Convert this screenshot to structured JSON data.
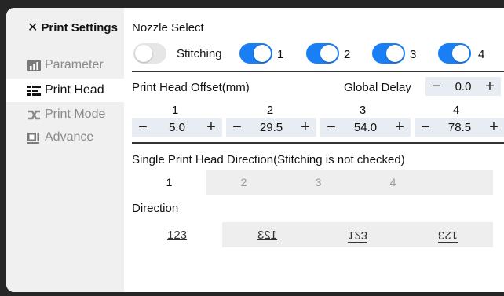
{
  "sidebar": {
    "close_glyph": "✕",
    "title": "Print Settings",
    "items": [
      {
        "label": "Parameter",
        "icon": "bar-chart-icon",
        "active": false
      },
      {
        "label": "Print Head",
        "icon": "list-icon",
        "active": true
      },
      {
        "label": "Print Mode",
        "icon": "shuffle-icon",
        "active": false
      },
      {
        "label": "Advance",
        "icon": "advance-icon",
        "active": false
      }
    ]
  },
  "nozzle": {
    "title": "Nozzle Select",
    "stitching_label": "Stitching",
    "stitching_on": false,
    "nozzles": [
      {
        "label": "1",
        "on": true
      },
      {
        "label": "2",
        "on": true
      },
      {
        "label": "3",
        "on": true
      },
      {
        "label": "4",
        "on": true
      }
    ],
    "accent_color": "#1a7ef5"
  },
  "offset": {
    "title": "Print Head Offset(mm)",
    "global_delay_label": "Global Delay",
    "global_delay_value": "0.0",
    "minus": "−",
    "plus": "+",
    "columns": [
      {
        "label": "1",
        "value": "5.0"
      },
      {
        "label": "2",
        "value": "29.5"
      },
      {
        "label": "3",
        "value": "54.0"
      },
      {
        "label": "4",
        "value": "78.5"
      }
    ]
  },
  "direction": {
    "title": "Single Print Head Direction(Stitching is not checked)",
    "heads": [
      "1",
      "2",
      "3",
      "4"
    ],
    "selected_head": "1",
    "direction_label": "Direction",
    "options": [
      "123",
      "123",
      "123",
      "123"
    ],
    "selected_option": 0
  }
}
